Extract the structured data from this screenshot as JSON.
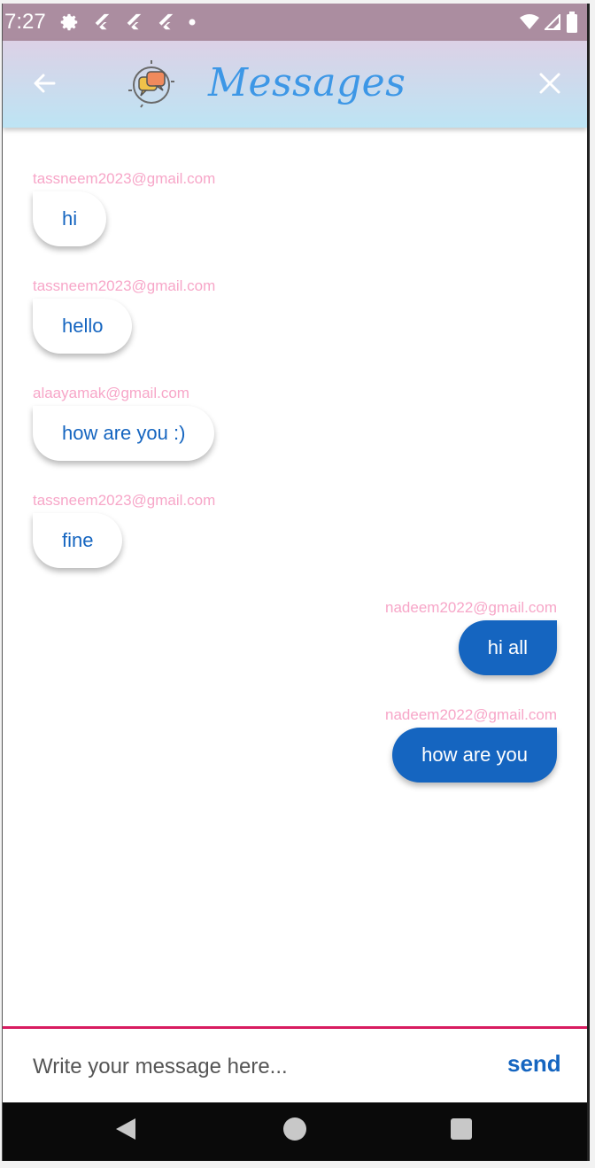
{
  "status_bar": {
    "time": "7:27"
  },
  "app_bar": {
    "title": "Messages"
  },
  "messages": [
    {
      "sender": "tassneem2023@gmail.com",
      "text": "hi",
      "side": "left"
    },
    {
      "sender": "tassneem2023@gmail.com",
      "text": "hello",
      "side": "left"
    },
    {
      "sender": "alaayamak@gmail.com",
      "text": "how are you :)",
      "side": "left"
    },
    {
      "sender": "tassneem2023@gmail.com",
      "text": "fine",
      "side": "left"
    },
    {
      "sender": "nadeem2022@gmail.com",
      "text": "hi all",
      "side": "right"
    },
    {
      "sender": "nadeem2022@gmail.com",
      "text": "how are you",
      "side": "right"
    }
  ],
  "composer": {
    "placeholder": "Write your message here...",
    "send_label": "send"
  },
  "colors": {
    "accent": "#1565c0",
    "title": "#3d97e6",
    "sender_email": "#f7a6c8",
    "divider": "#d81b60",
    "status_bar": "#ab8da0"
  },
  "icons": {
    "back": "arrow-left-icon",
    "close": "close-icon",
    "logo": "chat-bubbles-logo-icon"
  }
}
